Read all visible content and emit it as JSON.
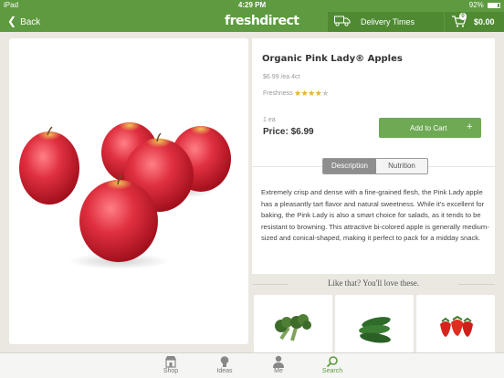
{
  "status_bar": {
    "device": "iPad",
    "time": "4:29 PM",
    "battery": "92%"
  },
  "nav": {
    "back_label": "Back",
    "logo": "freshdirect",
    "delivery_label": "Delivery Times",
    "cart_count": "0",
    "cart_total": "$0.00"
  },
  "product": {
    "title": "Organic Pink Lady® Apples",
    "unit_price": "$6.99 /ea 4ct",
    "freshness_label": "Freshness",
    "freshness_rating": 4,
    "freshness_max": 5,
    "quantity": "1 ea",
    "price": "Price: $6.99",
    "add_to_cart_label": "Add to Cart",
    "add_symbol": "+",
    "tabs": {
      "description": "Description",
      "nutrition": "Nutrition"
    },
    "description": "Extremely crisp and dense with a fine-grained flesh, the Pink Lady apple has a pleasantly tart flavor and natural sweetness. While it's excellent for baking, the Pink Lady is also a smart choice for salads, as it tends to be resistant to browning. This attractive bi-colored apple is generally medium-sized and conical-shaped, making it perfect to pack for a midday snack."
  },
  "recommendations": {
    "title": "Like that? You'll love these."
  },
  "tab_bar": {
    "items": [
      {
        "label": "Shop",
        "icon": "shop-icon"
      },
      {
        "label": "Ideas",
        "icon": "lightbulb-icon"
      },
      {
        "label": "Me",
        "icon": "person-icon"
      },
      {
        "label": "Search",
        "icon": "search-icon"
      }
    ],
    "active": "Search"
  },
  "colors": {
    "brand_green": "#5e9a3f",
    "button_green": "#6ea954",
    "star_gold": "#e7b12d"
  }
}
